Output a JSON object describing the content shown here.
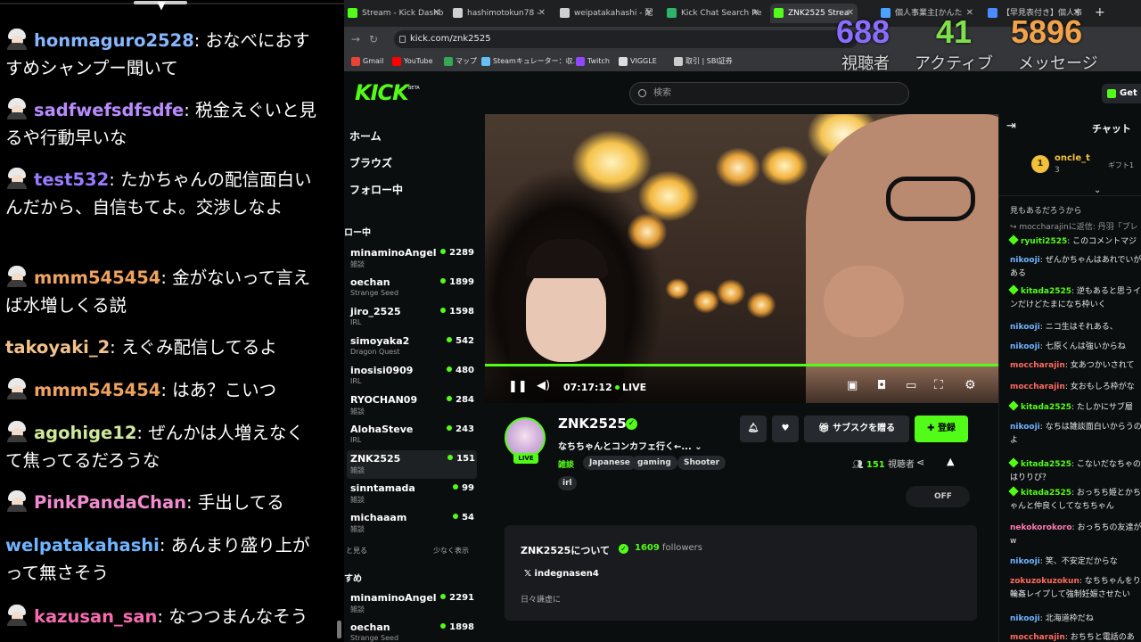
{
  "overlay_chat": {
    "messages": [
      {
        "user": "honmaguro2528",
        "color": "#87b8ff",
        "avatar": true,
        "text": "おなべにおすすめシャンプー聞いて"
      },
      {
        "user": "sadfwefsdfsdfe",
        "color": "#b98bff",
        "avatar": true,
        "text": "税金えぐいと見るや行動早いな"
      },
      {
        "user": "test532",
        "color": "#9a7bff",
        "avatar": true,
        "text": "たかちゃんの配信面白いんだから、自信もてよ。交渉しなよ"
      },
      {
        "user": "mmm545454",
        "color": "#f0a35e",
        "avatar": true,
        "text": "金がないって言えば水増しくる説"
      },
      {
        "user": "takoyaki_2",
        "color": "#f2c28c",
        "avatar": false,
        "text": "えぐみ配信してるよ"
      },
      {
        "user": "mmm545454",
        "color": "#f0a35e",
        "avatar": true,
        "text": "はあ？こいつ"
      },
      {
        "user": "agohige12",
        "color": "#d0e89a",
        "avatar": true,
        "text": "ぜんかは人増えなくて焦ってるだろうな"
      },
      {
        "user": "PinkPandaChan",
        "color": "#f28ad0",
        "avatar": true,
        "text": "手出してる"
      },
      {
        "user": "welpatakahashi",
        "color": "#6fb4ff",
        "avatar": false,
        "text": "あんまり盛り上がって無さそう"
      },
      {
        "user": "kazusan_san",
        "color": "#f56bb0",
        "avatar": true,
        "text": "なつつまんなそう"
      }
    ]
  },
  "browser": {
    "tabs": [
      {
        "label": "Stream - Kick Dashb",
        "icon_color": "#53fc18",
        "active": false
      },
      {
        "label": "hashimotokun78 - ",
        "icon_color": "#cfcfcf",
        "active": false
      },
      {
        "label": "weipatakahashi - 配",
        "icon_color": "#cfcfcf",
        "active": false
      },
      {
        "label": "Kick Chat Search Re",
        "icon_color": "#2fb36a",
        "active": false
      },
      {
        "label": "ZNK2525 Strea",
        "icon_color": "#53fc18",
        "active": true
      },
      {
        "label": "個人事業主[かんた",
        "icon_color": "#4aa3ff",
        "active": false
      },
      {
        "label": "【早見表付き】個人事",
        "icon_color": "#4a8cff",
        "active": false
      }
    ],
    "tab_plus": "+",
    "url": "kick.com/znk2525",
    "bookmarks": [
      {
        "label": "Gmail",
        "color": "#ea4335"
      },
      {
        "label": "YouTube",
        "color": "#ff0000"
      },
      {
        "label": "マップ",
        "color": "#34a853"
      },
      {
        "label": "Steamキュレーター：収...",
        "color": "#66c0f4"
      },
      {
        "label": "Twitch",
        "color": "#9146ff"
      },
      {
        "label": "VIGGLE",
        "color": "#dddddd"
      },
      {
        "label": "取引 | SBI証券",
        "color": "#cccccc"
      }
    ]
  },
  "stats": {
    "viewers": {
      "value": "688",
      "label": "視聴者",
      "color": "#8a6cff"
    },
    "active": {
      "value": "41",
      "label": "アクティブ",
      "color": "#7fe04a"
    },
    "messages": {
      "value": "5896",
      "label": "メッセージ",
      "color": "#f2a34a"
    }
  },
  "kick": {
    "logo": "KICK",
    "beta": "BETA",
    "search_placeholder": "検索",
    "get_app": "Get",
    "nav": [
      "ホーム",
      "ブラウズ",
      "フォロー中"
    ],
    "following_header": "ロー中",
    "following": [
      {
        "name": "minaminoAngel",
        "category": "雑談",
        "viewers": "2289",
        "selected": false
      },
      {
        "name": "oechan",
        "category": "Strange Seed",
        "viewers": "1899",
        "selected": false
      },
      {
        "name": "jiro_2525",
        "category": "IRL",
        "viewers": "1598",
        "selected": false
      },
      {
        "name": "simoyaka2",
        "category": "Dragon Quest",
        "viewers": "542",
        "selected": false
      },
      {
        "name": "inosisi0909",
        "category": "IRL",
        "viewers": "480",
        "selected": false
      },
      {
        "name": "RYOCHAN09",
        "category": "雑談",
        "viewers": "284",
        "selected": false
      },
      {
        "name": "AlohaSteve",
        "category": "IRL",
        "viewers": "243",
        "selected": false
      },
      {
        "name": "ZNK2525",
        "category": "雑談",
        "viewers": "151",
        "selected": true
      },
      {
        "name": "sinntamada",
        "category": "雑談",
        "viewers": "99",
        "selected": false
      },
      {
        "name": "michaaam",
        "category": "雑談",
        "viewers": "54",
        "selected": false
      }
    ],
    "show_more": "と見る",
    "show_less": "少なく表示",
    "recommended_header": "すめ",
    "recommended": [
      {
        "name": "minaminoAngel",
        "category": "雑談",
        "viewers": "2291"
      },
      {
        "name": "oechan",
        "category": "Strange Seed",
        "viewers": "1898"
      }
    ]
  },
  "player": {
    "time": "07:17:12",
    "live": "LIVE",
    "progress": 1.0
  },
  "channel": {
    "name": "ZNK2525",
    "verified": "✓",
    "live_badge": "LIVE",
    "title": "なちちゃんとコンカフェ行く←...",
    "category": "雑談",
    "tags": [
      "Japanese",
      "gaming",
      "Shooter",
      "irl"
    ],
    "subscribe_gift": "サブスクを贈る",
    "follow": "登録",
    "viewers_count": "151",
    "viewers_label": "視聴者",
    "off_label": "OFF",
    "about_title": "ZNK2525について",
    "followers_count": "1609",
    "followers_label": "followers",
    "x_handle": "indegnasen4",
    "description": "日々謙虚に"
  },
  "right_chat": {
    "title": "チャット",
    "pinned": {
      "user": "oncle_t",
      "rank": "1",
      "sub": "3",
      "gift": "ギフト1"
    },
    "messages": [
      {
        "user": "",
        "color": "#cccccc",
        "badge": false,
        "text": "見もあるだろうから"
      },
      {
        "user": "",
        "color": "#999999",
        "badge": false,
        "text": "↪ moccharajinに返信: 丹羽「プレ"
      },
      {
        "user": "ryuiti2525",
        "color": "#53fc18",
        "badge": true,
        "text": "このコメントマジ"
      },
      {
        "user": "nikooji",
        "color": "#6fb4ff",
        "badge": false,
        "text": "ぜんかちゃんはあれでいがある"
      },
      {
        "user": "kitada2525",
        "color": "#53fc18",
        "badge": true,
        "text": "逆もあると思うインだけどたまになち枠いく"
      },
      {
        "user": "nikooji",
        "color": "#6fb4ff",
        "badge": false,
        "text": "ニコ生はそれある、"
      },
      {
        "user": "nikooji",
        "color": "#6fb4ff",
        "badge": false,
        "text": "七原くんは強いからね"
      },
      {
        "user": "moccharajin",
        "color": "#ff6a5e",
        "badge": false,
        "text": "女あつかいされて"
      },
      {
        "user": "moccharajin",
        "color": "#ff6a5e",
        "badge": false,
        "text": "女おもしろ枠がな"
      },
      {
        "user": "kitada2525",
        "color": "#53fc18",
        "badge": true,
        "text": "たしかにサブ層"
      },
      {
        "user": "nikooji",
        "color": "#6fb4ff",
        "badge": false,
        "text": "なちは雑談面白いからうのよ"
      },
      {
        "user": "kitada2525",
        "color": "#53fc18",
        "badge": true,
        "text": "こないだなちゃのはりりび？"
      },
      {
        "user": "kitada2525",
        "color": "#53fc18",
        "badge": true,
        "text": "おっちち姫とかちゃんと仲良くしてなちちゃん"
      },
      {
        "user": "nekokorokoro",
        "color": "#ff7ab6",
        "badge": false,
        "text": "おっちちの友達がw"
      },
      {
        "user": "nikooji",
        "color": "#6fb4ff",
        "badge": false,
        "text": "笑、不安定だからな"
      },
      {
        "user": "zokuzokuzokun",
        "color": "#ff6a5e",
        "badge": false,
        "text": "なちちゃんをり輪姦レイプして強制妊娠させたい"
      },
      {
        "user": "nikooji",
        "color": "#6fb4ff",
        "badge": false,
        "text": "北海道枠だね"
      },
      {
        "user": "moccharajin",
        "color": "#ff6a5e",
        "badge": false,
        "text": "おちちと電話のあ"
      }
    ]
  }
}
